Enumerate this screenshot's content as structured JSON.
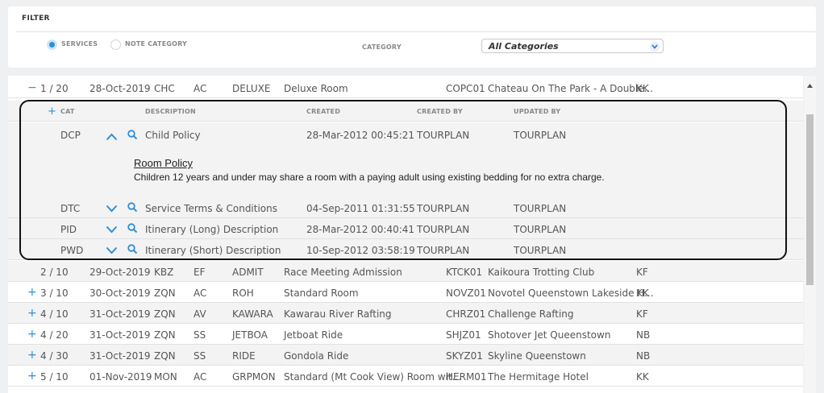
{
  "filter": {
    "title": "FILTER",
    "radio_services": "SERVICES",
    "radio_note_category": "NOTE CATEGORY",
    "category_label": "CATEGORY",
    "category_value": "All Categories"
  },
  "rows": [
    {
      "ctl": "−",
      "seq": "1 / 20",
      "date": "28-Oct-2019",
      "loc": "CHC",
      "type": "AC",
      "code": "DELUXE",
      "desc": "Deluxe Room",
      "sup_code": "COPC01",
      "supplier": "Chateau On The Park - A Double...",
      "status": "KK"
    },
    {
      "ctl": "",
      "seq": "2 / 10",
      "date": "29-Oct-2019",
      "loc": "KBZ",
      "type": "EF",
      "code": "ADMIT",
      "desc": "Race Meeting Admission",
      "sup_code": "KTCK01",
      "supplier": "Kaikoura Trotting Club",
      "status": "KF"
    },
    {
      "ctl": "+",
      "seq": "3 / 10",
      "date": "30-Oct-2019",
      "loc": "ZQN",
      "type": "AC",
      "code": "ROH",
      "desc": "Standard Room",
      "sup_code": "NOVZ01",
      "supplier": "Novotel Queenstown Lakeside H...",
      "status": "KK"
    },
    {
      "ctl": "+",
      "seq": "4 / 10",
      "date": "31-Oct-2019",
      "loc": "ZQN",
      "type": "AV",
      "code": "KAWARA",
      "desc": "Kawarau River Rafting",
      "sup_code": "CHRZ01",
      "supplier": "Challenge Rafting",
      "status": "KF"
    },
    {
      "ctl": "+",
      "seq": "4 / 20",
      "date": "31-Oct-2019",
      "loc": "ZQN",
      "type": "SS",
      "code": "JETBOA",
      "desc": "Jetboat Ride",
      "sup_code": "SHJZ01",
      "supplier": "Shotover Jet Queenstown",
      "status": "NB"
    },
    {
      "ctl": "+",
      "seq": "4 / 30",
      "date": "31-Oct-2019",
      "loc": "ZQN",
      "type": "SS",
      "code": "RIDE",
      "desc": "Gondola Ride",
      "sup_code": "SKYZ01",
      "supplier": "Skyline Queenstown",
      "status": "NB"
    },
    {
      "ctl": "+",
      "seq": "5 / 10",
      "date": "01-Nov-2019",
      "loc": "MON",
      "type": "AC",
      "code": "GRPMON",
      "desc": "Standard (Mt Cook View) Room wit...",
      "sup_code": "HERM01",
      "supplier": "The Hermitage Hotel",
      "status": "KK"
    }
  ],
  "notes": {
    "headers": {
      "add": "+",
      "cat": "CAT",
      "description": "DESCRIPTION",
      "created": "CREATED",
      "created_by": "CREATED BY",
      "updated_by": "UPDATED BY"
    },
    "items": [
      {
        "cat": "DCP",
        "desc": "Child Policy",
        "created": "28-Mar-2012 00:45:21",
        "created_by": "TOURPLAN",
        "updated_by": "TOURPLAN"
      },
      {
        "cat": "DTC",
        "desc": "Service Terms & Conditions",
        "created": "04-Sep-2011 01:31:55",
        "created_by": "TOURPLAN",
        "updated_by": "TOURPLAN"
      },
      {
        "cat": "PID",
        "desc": "Itinerary (Long) Description",
        "created": "28-Mar-2012 00:40:41",
        "created_by": "TOURPLAN",
        "updated_by": "TOURPLAN"
      },
      {
        "cat": "PWD",
        "desc": "Itinerary (Short) Description",
        "created": "10-Sep-2012 03:58:19",
        "created_by": "TOURPLAN",
        "updated_by": "TOURPLAN"
      }
    ],
    "expanded": {
      "title": "Room Policy",
      "text": "Children 12 years and under may share a room with a paying adult using existing bedding for no extra charge."
    }
  },
  "icons": {
    "collapse": "chevron-up-icon",
    "expand": "chevron-down-icon",
    "view": "search-icon"
  },
  "colors": {
    "accent": "#2f8fd8",
    "border": "#111111"
  }
}
